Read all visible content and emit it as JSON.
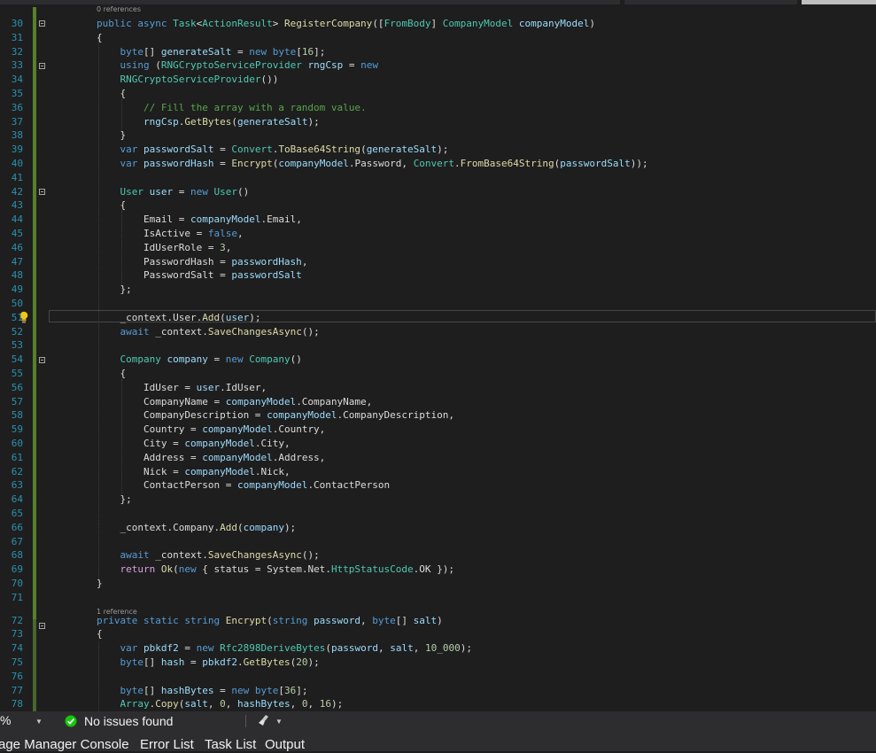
{
  "ref_labels": {
    "first": "0 references",
    "second": "1 reference"
  },
  "line_numbers": [
    "30",
    "31",
    "32",
    "33",
    "34",
    "35",
    "36",
    "37",
    "38",
    "39",
    "40",
    "41",
    "42",
    "43",
    "44",
    "45",
    "46",
    "47",
    "48",
    "49",
    "50",
    "51",
    "52",
    "53",
    "54",
    "55",
    "56",
    "57",
    "58",
    "59",
    "60",
    "61",
    "62",
    "63",
    "64",
    "65",
    "66",
    "67",
    "68",
    "69",
    "70",
    "71",
    "72",
    "73",
    "74",
    "75",
    "76",
    "77",
    "78"
  ],
  "code_lines": [
    [
      [
        "k",
        "public "
      ],
      [
        "k",
        "async "
      ],
      [
        "t",
        "Task"
      ],
      [
        "p",
        "<"
      ],
      [
        "t",
        "ActionResult"
      ],
      [
        "p",
        "> "
      ],
      [
        "m",
        "RegisterCompany"
      ],
      [
        "p",
        "(["
      ],
      [
        "t",
        "FromBody"
      ],
      [
        "p",
        "] "
      ],
      [
        "t",
        "CompanyModel "
      ],
      [
        "v",
        "companyModel"
      ],
      [
        "p",
        ")"
      ]
    ],
    [
      [
        "p",
        "{"
      ]
    ],
    [
      [
        "p",
        "    "
      ],
      [
        "k",
        "byte"
      ],
      [
        "p",
        "[] "
      ],
      [
        "v",
        "generateSalt"
      ],
      [
        "p",
        " = "
      ],
      [
        "k",
        "new "
      ],
      [
        "k",
        "byte"
      ],
      [
        "p",
        "["
      ],
      [
        "n",
        "16"
      ],
      [
        "p",
        "];"
      ]
    ],
    [
      [
        "p",
        "    "
      ],
      [
        "k",
        "using "
      ],
      [
        "p",
        "("
      ],
      [
        "t",
        "RNGCryptoServiceProvider "
      ],
      [
        "v",
        "rngCsp"
      ],
      [
        "p",
        " = "
      ],
      [
        "k",
        "new"
      ]
    ],
    [
      [
        "p",
        "    "
      ],
      [
        "t",
        "RNGCryptoServiceProvider"
      ],
      [
        "p",
        "())"
      ]
    ],
    [
      [
        "p",
        "    {"
      ]
    ],
    [
      [
        "p",
        "        "
      ],
      [
        "c",
        "// Fill the array with a random value."
      ]
    ],
    [
      [
        "p",
        "        "
      ],
      [
        "v",
        "rngCsp"
      ],
      [
        "p",
        "."
      ],
      [
        "m",
        "GetBytes"
      ],
      [
        "p",
        "("
      ],
      [
        "v",
        "generateSalt"
      ],
      [
        "p",
        ");"
      ]
    ],
    [
      [
        "p",
        "    }"
      ]
    ],
    [
      [
        "p",
        "    "
      ],
      [
        "k",
        "var "
      ],
      [
        "v",
        "passwordSalt"
      ],
      [
        "p",
        " = "
      ],
      [
        "t",
        "Convert"
      ],
      [
        "p",
        "."
      ],
      [
        "m",
        "ToBase64String"
      ],
      [
        "p",
        "("
      ],
      [
        "v",
        "generateSalt"
      ],
      [
        "p",
        ");"
      ]
    ],
    [
      [
        "p",
        "    "
      ],
      [
        "k",
        "var "
      ],
      [
        "v",
        "passwordHash"
      ],
      [
        "p",
        " = "
      ],
      [
        "m",
        "Encrypt"
      ],
      [
        "p",
        "("
      ],
      [
        "v",
        "companyModel"
      ],
      [
        "p",
        ".Password, "
      ],
      [
        "t",
        "Convert"
      ],
      [
        "p",
        "."
      ],
      [
        "m",
        "FromBase64String"
      ],
      [
        "p",
        "("
      ],
      [
        "v",
        "passwordSalt"
      ],
      [
        "p",
        "));"
      ]
    ],
    [],
    [
      [
        "p",
        "    "
      ],
      [
        "t",
        "User "
      ],
      [
        "v",
        "user"
      ],
      [
        "p",
        " = "
      ],
      [
        "k",
        "new "
      ],
      [
        "t",
        "User"
      ],
      [
        "p",
        "()"
      ]
    ],
    [
      [
        "p",
        "    {"
      ]
    ],
    [
      [
        "p",
        "        Email = "
      ],
      [
        "v",
        "companyModel"
      ],
      [
        "p",
        ".Email,"
      ]
    ],
    [
      [
        "p",
        "        IsActive = "
      ],
      [
        "k",
        "false"
      ],
      [
        "p",
        ","
      ]
    ],
    [
      [
        "p",
        "        IdUserRole = "
      ],
      [
        "n",
        "3"
      ],
      [
        "p",
        ","
      ]
    ],
    [
      [
        "p",
        "        PasswordHash = "
      ],
      [
        "v",
        "passwordHash"
      ],
      [
        "p",
        ","
      ]
    ],
    [
      [
        "p",
        "        PasswordSalt = "
      ],
      [
        "v",
        "passwordSalt"
      ]
    ],
    [
      [
        "p",
        "    };"
      ]
    ],
    [],
    [
      [
        "p",
        "    _context.User."
      ],
      [
        "m",
        "Add"
      ],
      [
        "p",
        "("
      ],
      [
        "v",
        "user"
      ],
      [
        "p",
        ");"
      ]
    ],
    [
      [
        "p",
        "    "
      ],
      [
        "k",
        "await "
      ],
      [
        "p",
        "_context."
      ],
      [
        "m",
        "SaveChangesAsync"
      ],
      [
        "p",
        "();"
      ]
    ],
    [],
    [
      [
        "p",
        "    "
      ],
      [
        "t",
        "Company "
      ],
      [
        "v",
        "company"
      ],
      [
        "p",
        " = "
      ],
      [
        "k",
        "new "
      ],
      [
        "t",
        "Company"
      ],
      [
        "p",
        "()"
      ]
    ],
    [
      [
        "p",
        "    {"
      ]
    ],
    [
      [
        "p",
        "        IdUser = "
      ],
      [
        "v",
        "user"
      ],
      [
        "p",
        ".IdUser,"
      ]
    ],
    [
      [
        "p",
        "        CompanyName = "
      ],
      [
        "v",
        "companyModel"
      ],
      [
        "p",
        ".CompanyName,"
      ]
    ],
    [
      [
        "p",
        "        CompanyDescription = "
      ],
      [
        "v",
        "companyModel"
      ],
      [
        "p",
        ".CompanyDescription,"
      ]
    ],
    [
      [
        "p",
        "        Country = "
      ],
      [
        "v",
        "companyModel"
      ],
      [
        "p",
        ".Country,"
      ]
    ],
    [
      [
        "p",
        "        City = "
      ],
      [
        "v",
        "companyModel"
      ],
      [
        "p",
        ".City,"
      ]
    ],
    [
      [
        "p",
        "        Address = "
      ],
      [
        "v",
        "companyModel"
      ],
      [
        "p",
        ".Address,"
      ]
    ],
    [
      [
        "p",
        "        Nick = "
      ],
      [
        "v",
        "companyModel"
      ],
      [
        "p",
        ".Nick,"
      ]
    ],
    [
      [
        "p",
        "        ContactPerson = "
      ],
      [
        "v",
        "companyModel"
      ],
      [
        "p",
        ".ContactPerson"
      ]
    ],
    [
      [
        "p",
        "    };"
      ]
    ],
    [],
    [
      [
        "p",
        "    _context.Company."
      ],
      [
        "m",
        "Add"
      ],
      [
        "p",
        "("
      ],
      [
        "v",
        "company"
      ],
      [
        "p",
        ");"
      ]
    ],
    [],
    [
      [
        "p",
        "    "
      ],
      [
        "k",
        "await "
      ],
      [
        "p",
        "_context."
      ],
      [
        "m",
        "SaveChangesAsync"
      ],
      [
        "p",
        "();"
      ]
    ],
    [
      [
        "p",
        "    "
      ],
      [
        "ctl",
        "return "
      ],
      [
        "m",
        "Ok"
      ],
      [
        "p",
        "("
      ],
      [
        "k",
        "new "
      ],
      [
        "p",
        "{ status = System.Net."
      ],
      [
        "t",
        "HttpStatusCode"
      ],
      [
        "p",
        ".OK });"
      ]
    ],
    [
      [
        "p",
        "}"
      ]
    ],
    [],
    [
      [
        "k",
        "private "
      ],
      [
        "k",
        "static "
      ],
      [
        "k",
        "string "
      ],
      [
        "m",
        "Encrypt"
      ],
      [
        "p",
        "("
      ],
      [
        "k",
        "string "
      ],
      [
        "v",
        "password"
      ],
      [
        "p",
        ", "
      ],
      [
        "k",
        "byte"
      ],
      [
        "p",
        "[] "
      ],
      [
        "v",
        "salt"
      ],
      [
        "p",
        ")"
      ]
    ],
    [
      [
        "p",
        "{"
      ]
    ],
    [
      [
        "p",
        "    "
      ],
      [
        "k",
        "var "
      ],
      [
        "v",
        "pbkdf2"
      ],
      [
        "p",
        " = "
      ],
      [
        "k",
        "new "
      ],
      [
        "t",
        "Rfc2898DeriveBytes"
      ],
      [
        "p",
        "("
      ],
      [
        "v",
        "password"
      ],
      [
        "p",
        ", "
      ],
      [
        "v",
        "salt"
      ],
      [
        "p",
        ", "
      ],
      [
        "n",
        "10_000"
      ],
      [
        "p",
        ");"
      ]
    ],
    [
      [
        "p",
        "    "
      ],
      [
        "k",
        "byte"
      ],
      [
        "p",
        "[] "
      ],
      [
        "v",
        "hash"
      ],
      [
        "p",
        " = "
      ],
      [
        "v",
        "pbkdf2"
      ],
      [
        "p",
        "."
      ],
      [
        "m",
        "GetBytes"
      ],
      [
        "p",
        "("
      ],
      [
        "n",
        "20"
      ],
      [
        "p",
        ");"
      ]
    ],
    [],
    [
      [
        "p",
        "    "
      ],
      [
        "k",
        "byte"
      ],
      [
        "p",
        "[] "
      ],
      [
        "v",
        "hashBytes"
      ],
      [
        "p",
        " = "
      ],
      [
        "k",
        "new "
      ],
      [
        "k",
        "byte"
      ],
      [
        "p",
        "["
      ],
      [
        "n",
        "36"
      ],
      [
        "p",
        "];"
      ]
    ],
    [
      [
        "p",
        "    "
      ],
      [
        "t",
        "Array"
      ],
      [
        "p",
        "."
      ],
      [
        "m",
        "Copy"
      ],
      [
        "p",
        "("
      ],
      [
        "v",
        "salt"
      ],
      [
        "p",
        ", "
      ],
      [
        "n",
        "0"
      ],
      [
        "p",
        ", "
      ],
      [
        "v",
        "hashBytes"
      ],
      [
        "p",
        ", "
      ],
      [
        "n",
        "0"
      ],
      [
        "p",
        ", "
      ],
      [
        "n",
        "16"
      ],
      [
        "p",
        ");"
      ]
    ]
  ],
  "colors": {
    "keyword": "#569cd6",
    "type": "#4ec9b0",
    "method": "#dcdcaa",
    "variable": "#9cdcfe",
    "comment": "#57a64a",
    "number": "#b5cea8",
    "plain": "#dcdcdc",
    "control": "#d8a0df",
    "line_number": "#2b91af",
    "change_bar": "#57802c",
    "status_ok": "#16c60c"
  },
  "icons": {
    "gutter": "lightbulb-icon",
    "status": "check-circle-icon",
    "cleanup": "broom-icon"
  },
  "statusbar": {
    "zoom": "%",
    "issues": "No issues found"
  },
  "bottom_tabs": [
    "age Manager Console",
    "Error List",
    "Task List",
    "Output"
  ]
}
